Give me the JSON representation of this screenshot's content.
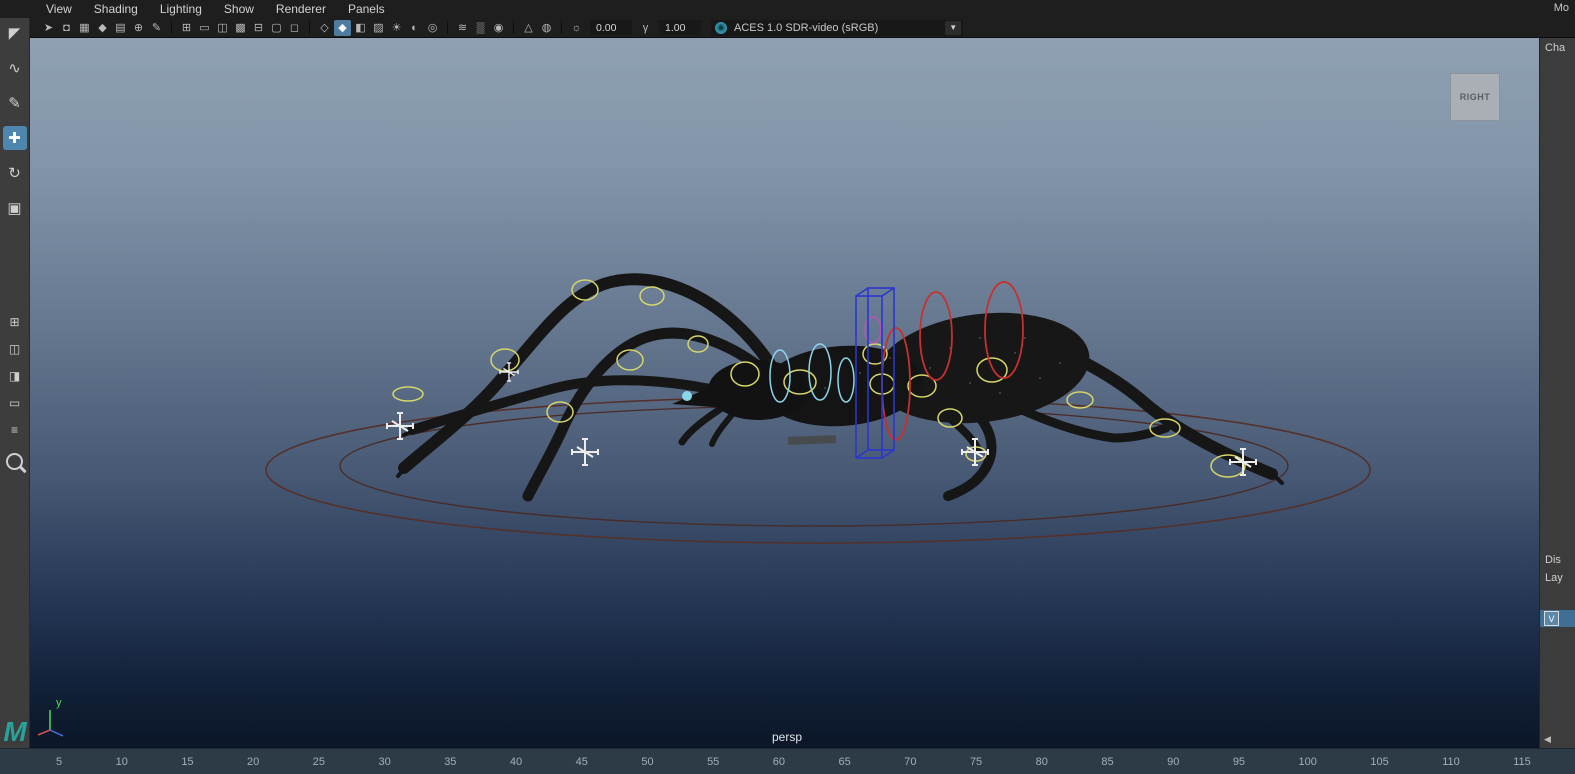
{
  "panel_menu": {
    "items": [
      "View",
      "Shading",
      "Lighting",
      "Show",
      "Renderer",
      "Panels"
    ]
  },
  "toolbar": {
    "exposure_value": "0.00",
    "gamma_value": "1.00",
    "color_space_label": "ACES 1.0 SDR-video (sRGB)"
  },
  "viewport": {
    "camera_label": "persp",
    "viewcube_label": "RIGHT",
    "axis_y_label": "y"
  },
  "right_panel": {
    "top_label": "Mo",
    "channel_label": "Cha",
    "display_tab": "Dis",
    "layer_tab": "Lay",
    "layer_visibility": "V",
    "collapse_arrow": "◀"
  },
  "timeline": {
    "ticks": [
      "5",
      "10",
      "15",
      "20",
      "25",
      "30",
      "35",
      "40",
      "45",
      "50",
      "55",
      "60",
      "65",
      "70",
      "75",
      "80",
      "85",
      "90",
      "95",
      "100",
      "105",
      "110",
      "115"
    ]
  },
  "colors": {
    "rig_yellow": "#d6d66a",
    "rig_cyan": "#8ad6e8",
    "rig_red": "#c63030",
    "rig_blue": "#2b36d0",
    "rig_root": "#55302a",
    "highlight_blue": "#4e7ca0"
  },
  "icons": {
    "select_camera": "➤",
    "lock_camera": "◘",
    "camera_attrs": "▦",
    "bookmark": "◆",
    "image_plane": "▤",
    "pan_zoom": "⊕",
    "grease_pencil": "✎",
    "grid": "⊞",
    "film_gate": "▭",
    "res_gate": "◫",
    "gate_mask": "▩",
    "field_chart": "⊟",
    "safe_action": "▢",
    "safe_title": "◻",
    "wireframe": "◇",
    "smooth_shade": "◆",
    "textured": "◧",
    "checker": "▨",
    "lights": "☀",
    "shadows": "◐",
    "ao": "◎",
    "motion_blur": "≋",
    "multisample": "▒",
    "dof": "◉",
    "isolate": "△",
    "xray": "◍",
    "exposure": "☼",
    "gamma": "γ",
    "color_swatch": "◉",
    "caret_down": "▼",
    "select_tool": "◤",
    "lasso_tool": "∿",
    "paint_tool": "✎",
    "move_tool": "✚",
    "rotate_tool": "↻",
    "scale_tool": "▣",
    "layout_four": "⊞",
    "layout_two": "◫",
    "layout_three": "◨",
    "layout_single": "▭",
    "outliner": "≡",
    "maya_logo": "M"
  }
}
